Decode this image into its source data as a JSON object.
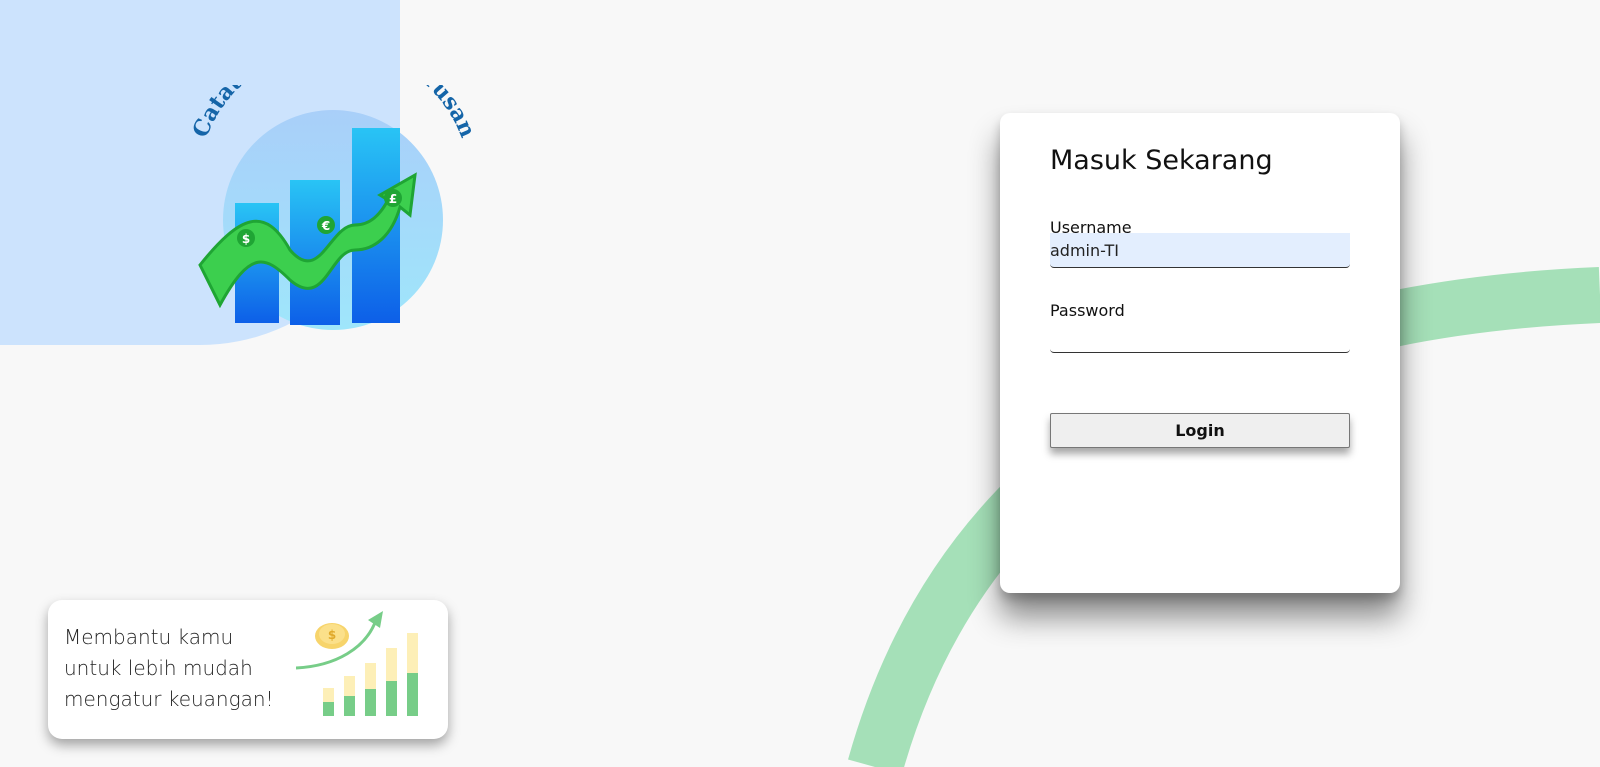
{
  "logo": {
    "text": "Catatan Keuangan Jurusan",
    "coin_symbols": [
      "$",
      "€",
      "£"
    ]
  },
  "login": {
    "title": "Masuk Sekarang",
    "username_label": "Username",
    "username_value": "admin-TI",
    "password_label": "Password",
    "password_value": "",
    "button_label": "Login"
  },
  "promo": {
    "lines": [
      "Membantu kamu",
      "untuk lebih mudah",
      "mengatur keuangan!"
    ],
    "coin_symbol": "$"
  },
  "colors": {
    "background": "#f8f8f8",
    "blob": "#cce3fd",
    "arc": "#a5e0b8",
    "logo_text": "#1565a8",
    "money_green": "#3ccf4e",
    "bar_blue": "#1e88e5"
  }
}
